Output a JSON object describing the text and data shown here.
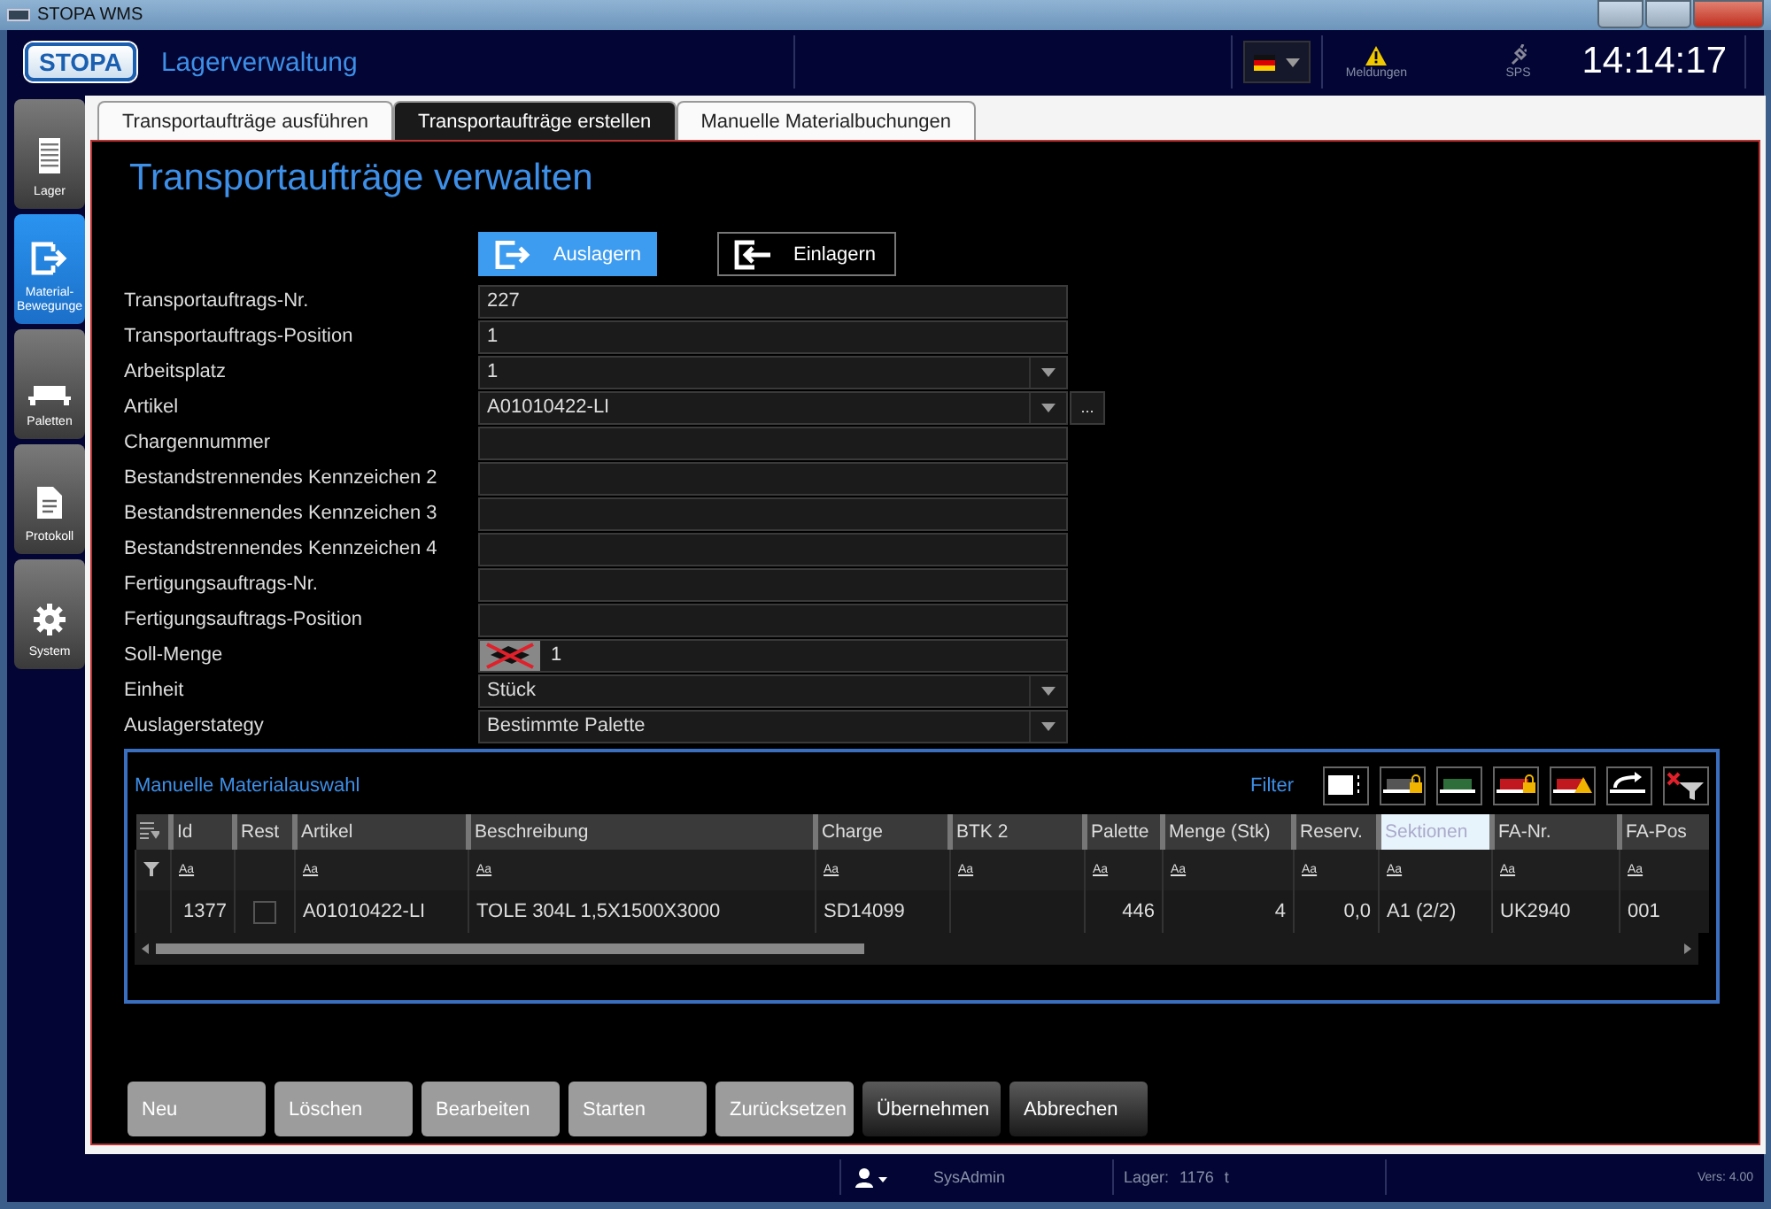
{
  "window": {
    "title": "STOPA WMS"
  },
  "header": {
    "logo": "STOPA",
    "title": "Lagerverwaltung",
    "messages_label": "Meldungen",
    "plc_label": "SPS",
    "clock": "14:14:17"
  },
  "sidebar": {
    "items": [
      {
        "label": "Lager",
        "selected": false
      },
      {
        "label": "Material-Bewegunge",
        "selected": true
      },
      {
        "label": "Paletten",
        "selected": false
      },
      {
        "label": "Protokoll",
        "selected": false
      },
      {
        "label": "System",
        "selected": false
      }
    ]
  },
  "tabs": [
    {
      "label": "Transportaufträge ausführen",
      "selected": false
    },
    {
      "label": "Transportaufträge erstellen",
      "selected": true
    },
    {
      "label": "Manuelle Materialbuchungen",
      "selected": false
    }
  ],
  "page_title": "Transportaufträge verwalten",
  "modes": [
    {
      "label": "Auslagern",
      "selected": true
    },
    {
      "label": "Einlagern",
      "selected": false
    }
  ],
  "form": [
    {
      "label": "Transportauftrags-Nr.",
      "kind": "text",
      "value": "227"
    },
    {
      "label": "Transportauftrags-Position",
      "kind": "text",
      "value": "1"
    },
    {
      "label": "Arbeitsplatz",
      "kind": "dropdown",
      "value": "1"
    },
    {
      "label": "Artikel",
      "kind": "dropdown",
      "value": "A01010422-LI",
      "extra_button": "..."
    },
    {
      "label": "Chargennummer",
      "kind": "text"
    },
    {
      "label": "Bestandstrennendes Kennzeichen 2",
      "kind": "text"
    },
    {
      "label": "Bestandstrennendes Kennzeichen 3",
      "kind": "text"
    },
    {
      "label": "Bestandstrennendes Kennzeichen 4",
      "kind": "text"
    },
    {
      "label": "Fertigungsauftrags-Nr.",
      "kind": "text"
    },
    {
      "label": "Fertigungsauftrags-Position",
      "kind": "text"
    },
    {
      "label": "Soll-Menge",
      "kind": "quantity",
      "value": "1"
    },
    {
      "label": "Einheit",
      "kind": "dropdown",
      "value": "Stück"
    },
    {
      "label": "Auslagerstategy",
      "kind": "dropdown",
      "value": "Bestimmte Palette"
    }
  ],
  "grid": {
    "title": "Manuelle Materialauswahl",
    "filter_label": "Filter",
    "columns": [
      {
        "label": "Id",
        "filter": "Aa",
        "selected": false
      },
      {
        "label": "Rest",
        "selected": false
      },
      {
        "label": "Artikel",
        "filter": "Aa",
        "selected": false
      },
      {
        "label": "Beschreibung",
        "filter": "Aa",
        "selected": false
      },
      {
        "label": "Charge",
        "filter": "Aa",
        "selected": false
      },
      {
        "label": "BTK 2",
        "filter": "Aa",
        "selected": false
      },
      {
        "label": "Palette",
        "filter": "Aa",
        "selected": false
      },
      {
        "label": "Menge (Stk)",
        "filter": "Aa",
        "selected": false
      },
      {
        "label": "Reserv.",
        "filter": "Aa",
        "selected": false
      },
      {
        "label": "Sektionen",
        "filter": "Aa",
        "selected": true
      },
      {
        "label": "FA-Nr.",
        "filter": "Aa",
        "selected": false
      },
      {
        "label": "FA-Pos",
        "filter": "Aa",
        "selected": false
      }
    ],
    "rows": [
      {
        "cells": [
          "1377",
          {
            "checked": false
          },
          "A01010422-LI",
          "TOLE 304L 1,5X1500X3000",
          "SD14099",
          "",
          "446",
          "4",
          "0,0",
          "A1 (2/2)",
          "UK2940",
          "001"
        ]
      }
    ]
  },
  "actions": [
    {
      "label": "Neu",
      "disabled": true
    },
    {
      "label": "Löschen",
      "disabled": true
    },
    {
      "label": "Bearbeiten",
      "disabled": true
    },
    {
      "label": "Starten",
      "disabled": true
    },
    {
      "label": "Zurücksetzen",
      "disabled": true
    },
    {
      "label": "Übernehmen",
      "disabled": false
    },
    {
      "label": "Abbrechen",
      "disabled": false
    }
  ],
  "status_bar": {
    "user": "SysAdmin",
    "storage_label": "Lager:",
    "storage_value": "1176",
    "storage_unit": "t",
    "version": "Vers: 4.00"
  }
}
